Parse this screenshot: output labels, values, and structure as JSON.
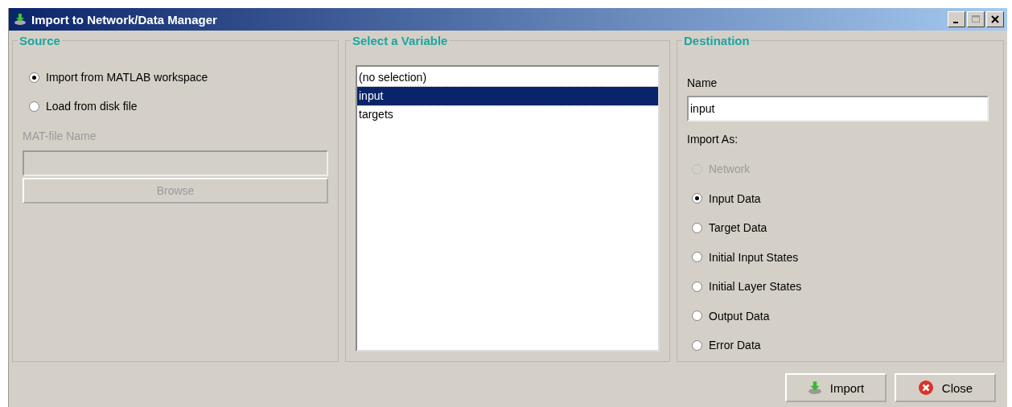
{
  "window": {
    "title": "Import to Network/Data Manager",
    "maximize_disabled": true
  },
  "source": {
    "title": "Source",
    "options": [
      {
        "label": "Import from MATLAB workspace",
        "selected": true
      },
      {
        "label": "Load from disk file",
        "selected": false
      }
    ],
    "file_label": "MAT-file Name",
    "file_disabled": true,
    "browse": "Browse",
    "browse_disabled": true
  },
  "variables": {
    "title": "Select a Variable",
    "items": [
      {
        "label": "(no selection)",
        "selected": false
      },
      {
        "label": "input",
        "selected": true
      },
      {
        "label": "targets",
        "selected": false
      }
    ]
  },
  "destination": {
    "title": "Destination",
    "name_label": "Name",
    "name_value": "input",
    "import_as": "Import As:",
    "options": [
      {
        "label": "Network",
        "selected": false,
        "disabled": true
      },
      {
        "label": "Input Data",
        "selected": true,
        "disabled": false
      },
      {
        "label": "Target Data",
        "selected": false,
        "disabled": false
      },
      {
        "label": "Initial Input States",
        "selected": false,
        "disabled": false
      },
      {
        "label": "Initial Layer States",
        "selected": false,
        "disabled": false
      },
      {
        "label": "Output Data",
        "selected": false,
        "disabled": false
      },
      {
        "label": "Error Data",
        "selected": false,
        "disabled": false
      }
    ]
  },
  "buttons": [
    {
      "label": "Import",
      "kind": "import"
    },
    {
      "label": "Close",
      "kind": "close"
    }
  ]
}
